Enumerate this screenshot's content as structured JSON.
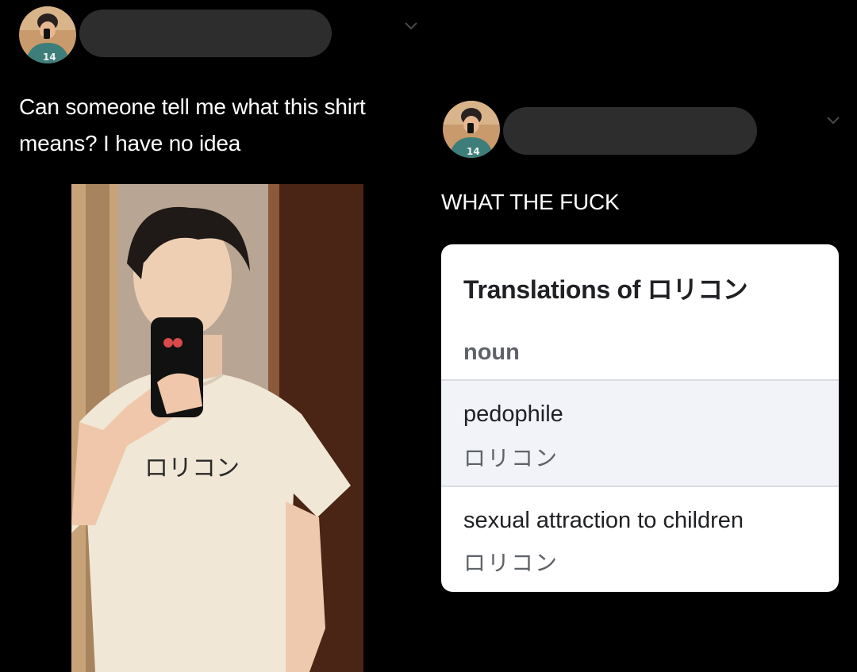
{
  "left_tweet": {
    "text_line1": "Can someone tell me what this shirt",
    "text_line2": "means? I have no idea",
    "avatar_icon": "user-avatar",
    "shirt_text": "ロリコン"
  },
  "right_tweet": {
    "text": "WHAT THE FUCK",
    "avatar_icon": "user-avatar"
  },
  "translation_card": {
    "title": "Translations of ロリコン",
    "part_of_speech": "noun",
    "entries": [
      {
        "word": "pedophile",
        "reverse": "ロリコン"
      },
      {
        "word": "sexual attraction to children",
        "reverse": "ロリコン"
      }
    ]
  },
  "colors": {
    "background": "#000000",
    "redaction": "#2d2d2d",
    "card": "#ffffff",
    "card_highlight": "#f1f3f8"
  }
}
